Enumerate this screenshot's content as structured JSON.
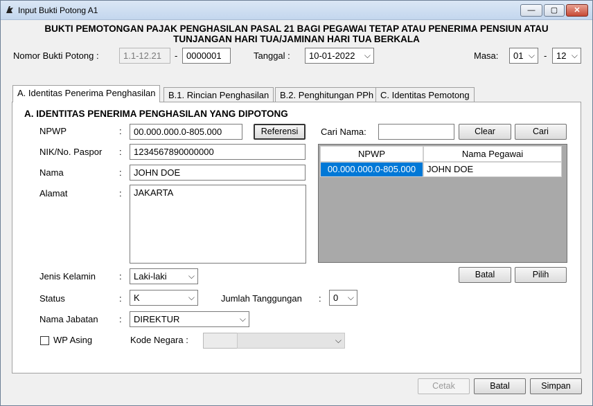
{
  "window": {
    "title": "Input Bukti Potong A1",
    "minimize": "—",
    "maximize": "▢",
    "close": "✕"
  },
  "header": {
    "line1": "BUKTI PEMOTONGAN PAJAK PENGHASILAN PASAL 21 BAGI PEGAWAI TETAP ATAU PENERIMA PENSIUN ATAU",
    "line2": "TUNJANGAN HARI TUA/JAMINAN HARI TUA BERKALA"
  },
  "top": {
    "nomor_label": "Nomor Bukti Potong :",
    "nomor_prefix": "1.1-12.21",
    "dash1": "-",
    "nomor_value": "0000001",
    "tanggal_label": "Tanggal :",
    "tanggal_value": "10-01-2022",
    "masa_label": "Masa:",
    "masa_from": "01",
    "dash2": "-",
    "masa_to": "12"
  },
  "tabs": [
    {
      "label": "A. Identitas Penerima Penghasilan"
    },
    {
      "label": "B.1. Rincian Penghasilan"
    },
    {
      "label": "B.2. Penghitungan PPh"
    },
    {
      "label": "C. Identitas Pemotong"
    }
  ],
  "section": {
    "title": "A. IDENTITAS PENERIMA PENGHASILAN YANG DIPOTONG",
    "colon": ":",
    "npwp_label": "NPWP",
    "npwp_value": "00.000.000.0-805.000",
    "referensi_btn": "Referensi",
    "nik_label": "NIK/No. Paspor",
    "nik_value": "1234567890000000",
    "nama_label": "Nama",
    "nama_value": "JOHN DOE",
    "alamat_label": "Alamat",
    "alamat_value": "JAKARTA",
    "jk_label": "Jenis Kelamin",
    "jk_value": "Laki-laki",
    "status_label": "Status",
    "status_value": "K",
    "tanggungan_label": "Jumlah Tanggungan",
    "tanggungan_value": "0",
    "jabatan_label": "Nama Jabatan",
    "jabatan_value": "DIREKTUR",
    "wp_asing_label": "WP Asing",
    "kode_negara_label": "Kode Negara :"
  },
  "search": {
    "label": "Cari Nama:",
    "value": "",
    "clear_btn": "Clear",
    "cari_btn": "Cari",
    "columns": [
      "NPWP",
      "Nama Pegawai"
    ],
    "rows": [
      [
        "00.000.000.0-805.000",
        "JOHN DOE"
      ]
    ],
    "batal_btn": "Batal",
    "pilih_btn": "Pilih"
  },
  "footer": {
    "cetak_btn": "Cetak",
    "batal_btn": "Batal",
    "simpan_btn": "Simpan"
  }
}
